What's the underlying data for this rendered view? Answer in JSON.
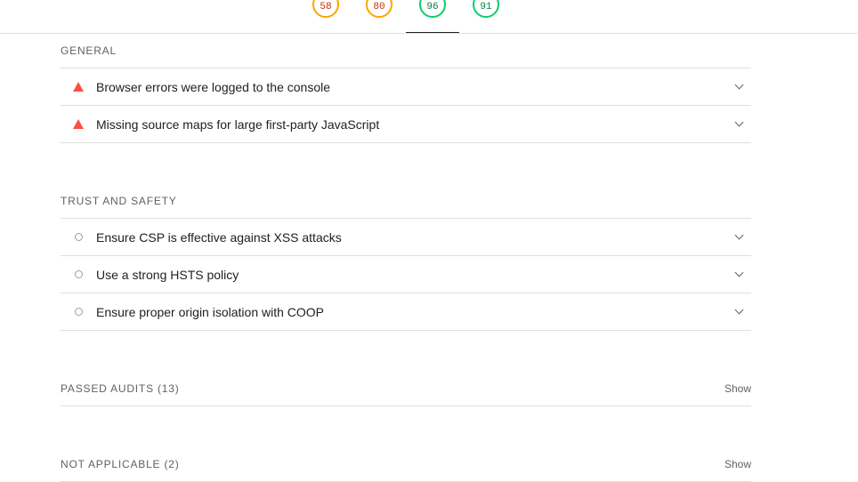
{
  "scores": [
    {
      "value": "58",
      "rating": "average"
    },
    {
      "value": "80",
      "rating": "average"
    },
    {
      "value": "96",
      "rating": "pass"
    },
    {
      "value": "91",
      "rating": "pass"
    }
  ],
  "general": {
    "title": "GENERAL",
    "audits": [
      {
        "label": "Browser errors were logged to the console",
        "status": "fail"
      },
      {
        "label": "Missing source maps for large first-party JavaScript",
        "status": "fail"
      }
    ]
  },
  "trust": {
    "title": "TRUST AND SAFETY",
    "audits": [
      {
        "label": "Ensure CSP is effective against XSS attacks",
        "status": "manual"
      },
      {
        "label": "Use a strong HSTS policy",
        "status": "manual"
      },
      {
        "label": "Ensure proper origin isolation with COOP",
        "status": "manual"
      }
    ]
  },
  "passed": {
    "title": "PASSED AUDITS",
    "count": "(13)",
    "show_label": "Show"
  },
  "not_applicable": {
    "title": "NOT APPLICABLE",
    "count": "(2)",
    "show_label": "Show"
  },
  "colors": {
    "fail": "#ff4e42",
    "average": "#ffa400",
    "pass": "#0cce6b"
  }
}
